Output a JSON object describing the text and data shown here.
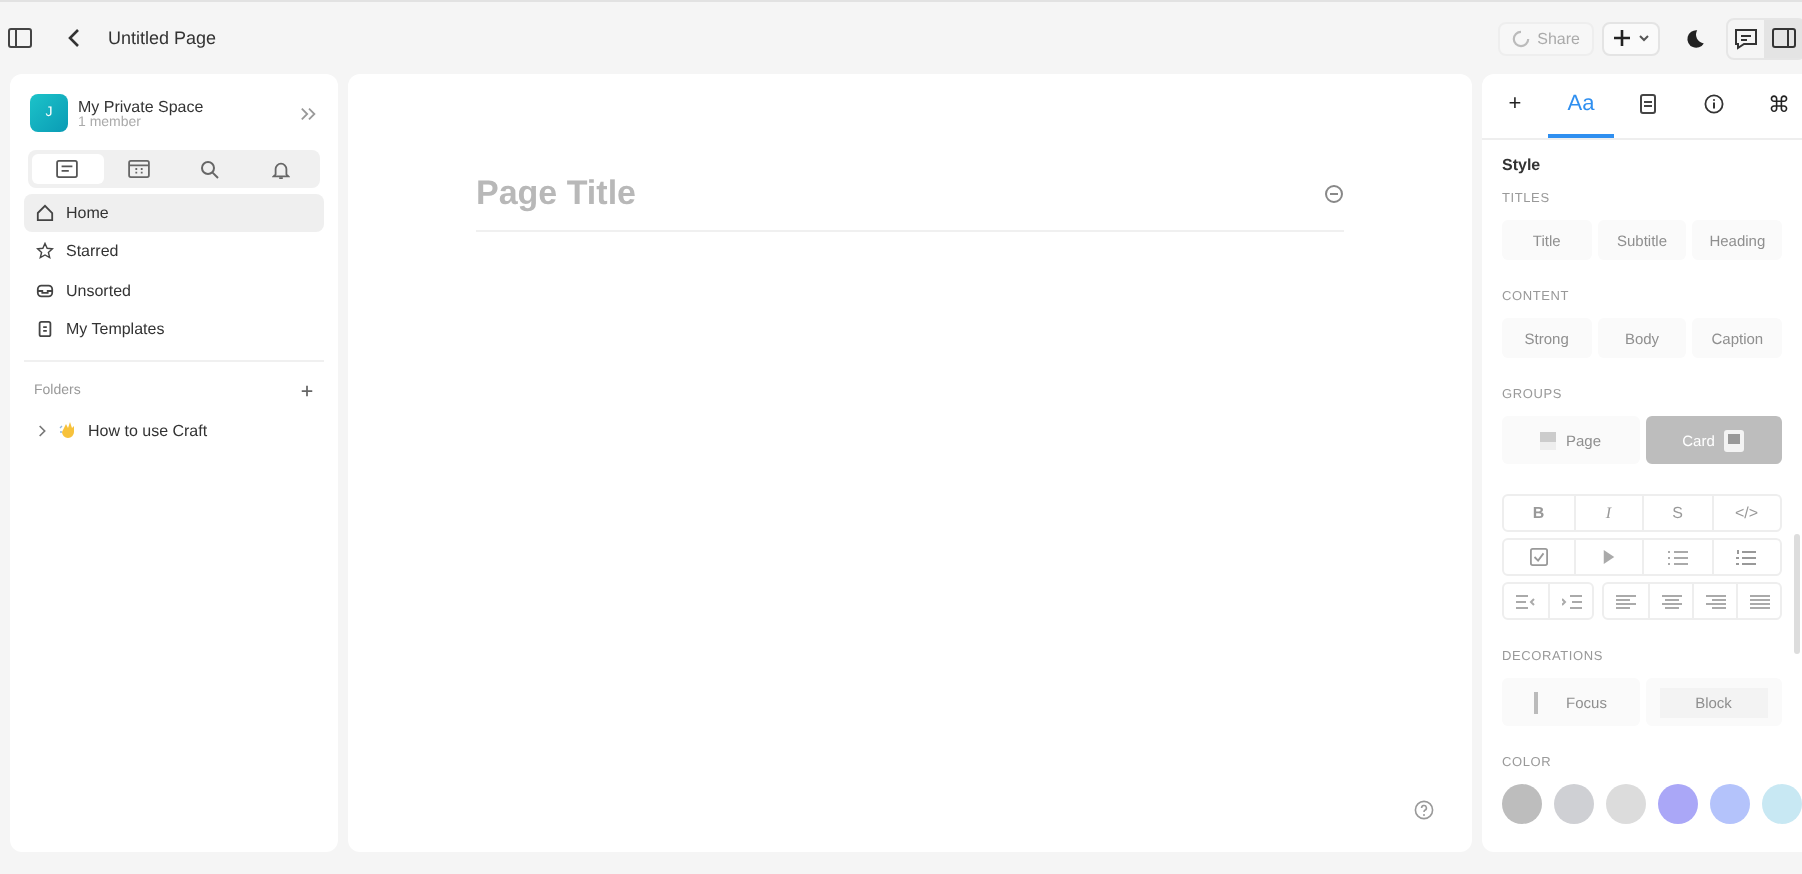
{
  "topbar": {
    "title": "Untitled Page",
    "share": "Share",
    "panel_toggle_selected": true
  },
  "sidebar": {
    "avatar": "J",
    "space": "My Private Space",
    "members": "1 member",
    "tabs": [
      {
        "selected": true
      },
      {
        "selected": false
      },
      {
        "selected": false
      },
      {
        "selected": false
      }
    ],
    "items": [
      {
        "label": "Home",
        "selected": true
      },
      {
        "label": "Starred",
        "selected": false
      },
      {
        "label": "Unsorted",
        "selected": false
      },
      {
        "label": "My Templates",
        "selected": false
      }
    ],
    "folders_label": "Folders",
    "folders": [
      {
        "label": "How to use Craft",
        "expanded": false
      }
    ]
  },
  "page": {
    "title_placeholder": "Page Title"
  },
  "panel": {
    "tabs": [
      {
        "label": "+",
        "selected": false
      },
      {
        "label": "Aa",
        "selected": true
      },
      {
        "selected": false
      },
      {
        "selected": false
      },
      {
        "label": "⌘",
        "selected": false
      }
    ],
    "heading": "Style",
    "sections": [
      {
        "title": "TITLES",
        "options": [
          {
            "label": "Title",
            "selected": false
          },
          {
            "label": "Subtitle",
            "selected": false
          },
          {
            "label": "Heading",
            "selected": false
          }
        ]
      },
      {
        "title": "CONTENT",
        "options": [
          {
            "label": "Strong",
            "selected": false
          },
          {
            "label": "Body",
            "selected": false
          },
          {
            "label": "Caption",
            "selected": false
          }
        ]
      },
      {
        "title": "GROUPS",
        "options": [
          {
            "label": "Page",
            "selected": false
          },
          {
            "label": "Card",
            "selected": true
          }
        ]
      }
    ],
    "format_buttons": [
      "B",
      "I",
      "S",
      "</>"
    ],
    "decorations_title": "DECORATIONS",
    "decorations": [
      {
        "label": "Focus",
        "selected": false
      },
      {
        "label": "Block",
        "selected": false
      }
    ],
    "color_title": "COLOR",
    "colors": [
      {
        "color": "#bdbdbd"
      },
      {
        "color": "#cfd0d4"
      },
      {
        "color": "#dcdcdc"
      },
      {
        "color": "#aaa7f7"
      },
      {
        "color": "#b4c3fb"
      },
      {
        "color": "#c8e8f3"
      }
    ]
  }
}
